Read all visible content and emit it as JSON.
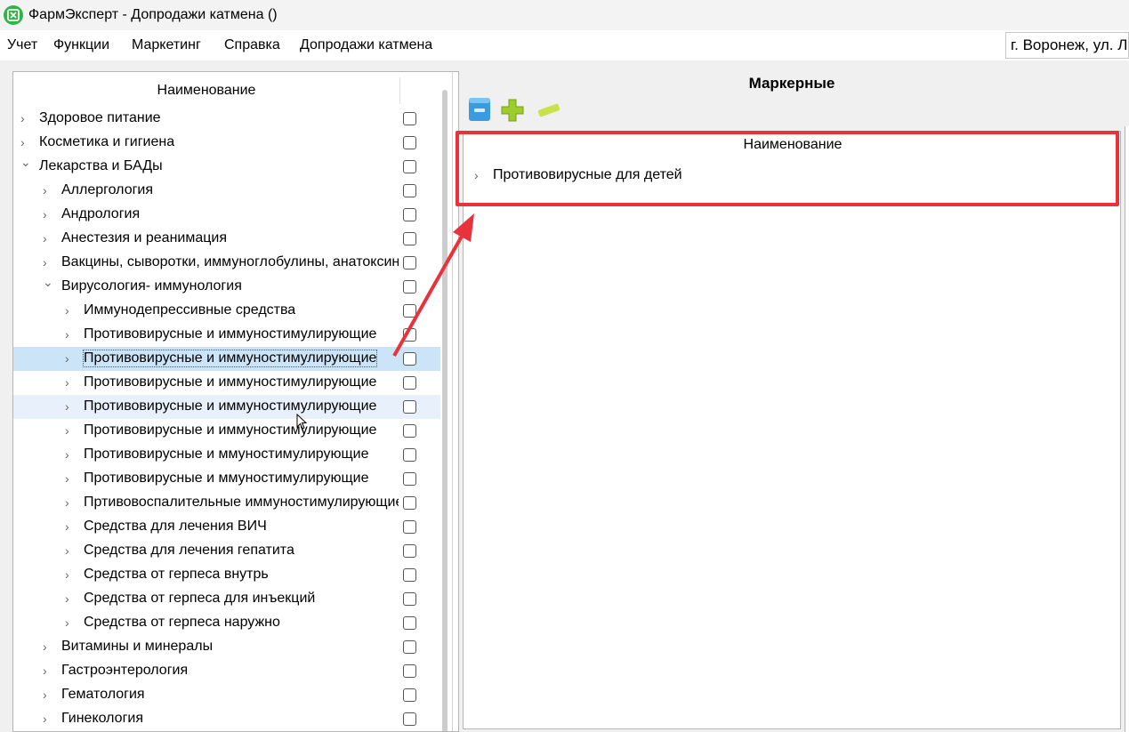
{
  "window": {
    "title": "ФармЭксперт - Допродажи катмена ()",
    "logo_icon": "pharm-expert-logo"
  },
  "menu": {
    "items": [
      "Учет",
      "Функции",
      "Маркетинг",
      "Справка",
      "Допродажи катмена"
    ],
    "location": "г. Воронеж, ул. Ли"
  },
  "left_tree": {
    "header": "Наименование",
    "rows": [
      {
        "label": "Здоровое питание",
        "expanded": false
      },
      {
        "label": "Косметика и гигиена",
        "expanded": false
      },
      {
        "label": "Лекарства и БАДы",
        "expanded": true
      },
      {
        "label": "Аллергология",
        "expanded": false
      },
      {
        "label": "Андрология",
        "expanded": false
      },
      {
        "label": "Анестезия и реанимация",
        "expanded": false
      },
      {
        "label": "Вакцины, сыворотки, иммуноглобулины, анатоксины",
        "expanded": false
      },
      {
        "label": "Вирусология- иммунология",
        "expanded": true
      },
      {
        "label": "Иммунодепрессивные средства",
        "expanded": false
      },
      {
        "label": "Противовирусные и иммуностимулирующие",
        "expanded": false
      },
      {
        "label": "Противовирусные и иммуностимулирующие",
        "expanded": false,
        "selected": true
      },
      {
        "label": "Противовирусные и иммуностимулирующие",
        "expanded": false
      },
      {
        "label": "Противовирусные и иммуностимулирующие",
        "expanded": false,
        "hover": true
      },
      {
        "label": "Противовирусные и иммуностимулирующие",
        "expanded": false
      },
      {
        "label": "Противовирусные и ммуностимулирующие",
        "expanded": false
      },
      {
        "label": "Противовирусные и ммуностимулирующие",
        "expanded": false
      },
      {
        "label": "Пртивовоспалительные иммуностимулирующие",
        "expanded": false
      },
      {
        "label": "Средства для лечения ВИЧ",
        "expanded": false
      },
      {
        "label": "Средства для лечения гепатита",
        "expanded": false
      },
      {
        "label": "Средства от герпеса внутрь",
        "expanded": false
      },
      {
        "label": "Средства от герпеса для инъекций",
        "expanded": false
      },
      {
        "label": "Средства от герпеса наружно",
        "expanded": false
      },
      {
        "label": "Витамины и минералы",
        "expanded": false
      },
      {
        "label": "Гастроэнтерология",
        "expanded": false
      },
      {
        "label": "Гематология",
        "expanded": false
      },
      {
        "label": "Гинекология",
        "expanded": false
      }
    ]
  },
  "right_panel": {
    "title": "Маркерные",
    "toolbar": [
      "database-icon",
      "add-icon",
      "remove-icon"
    ],
    "grid_header": "Наименование",
    "rows": [
      {
        "label": "Противовирусные для детей",
        "expanded": false
      }
    ]
  },
  "colors": {
    "highlight": "#e8323c",
    "selection": "#cce4f7",
    "logo": "#2fb44a"
  }
}
